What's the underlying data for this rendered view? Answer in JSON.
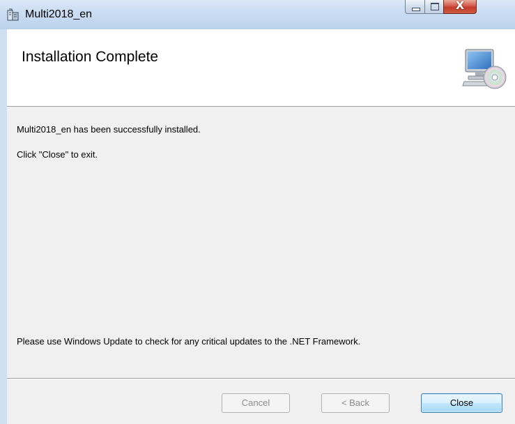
{
  "window": {
    "title": "Multi2018_en",
    "controls": {
      "minimize": "minimize",
      "maximize": "maximize",
      "close": "X"
    }
  },
  "header": {
    "title": "Installation Complete",
    "icon": "computer-cd-icon"
  },
  "body": {
    "line1": "Multi2018_en has been successfully installed.",
    "line2": "Click \"Close\" to exit.",
    "line3": "Please use Windows Update to check for any critical updates to the .NET Framework."
  },
  "buttons": {
    "cancel": "Cancel",
    "back": "< Back",
    "close": "Close"
  },
  "colors": {
    "titlebar": "#c9dcf2",
    "dialog_bg": "#f0f0f0",
    "close_button": "#c43b2b",
    "default_button_border": "#3c7fb1"
  }
}
